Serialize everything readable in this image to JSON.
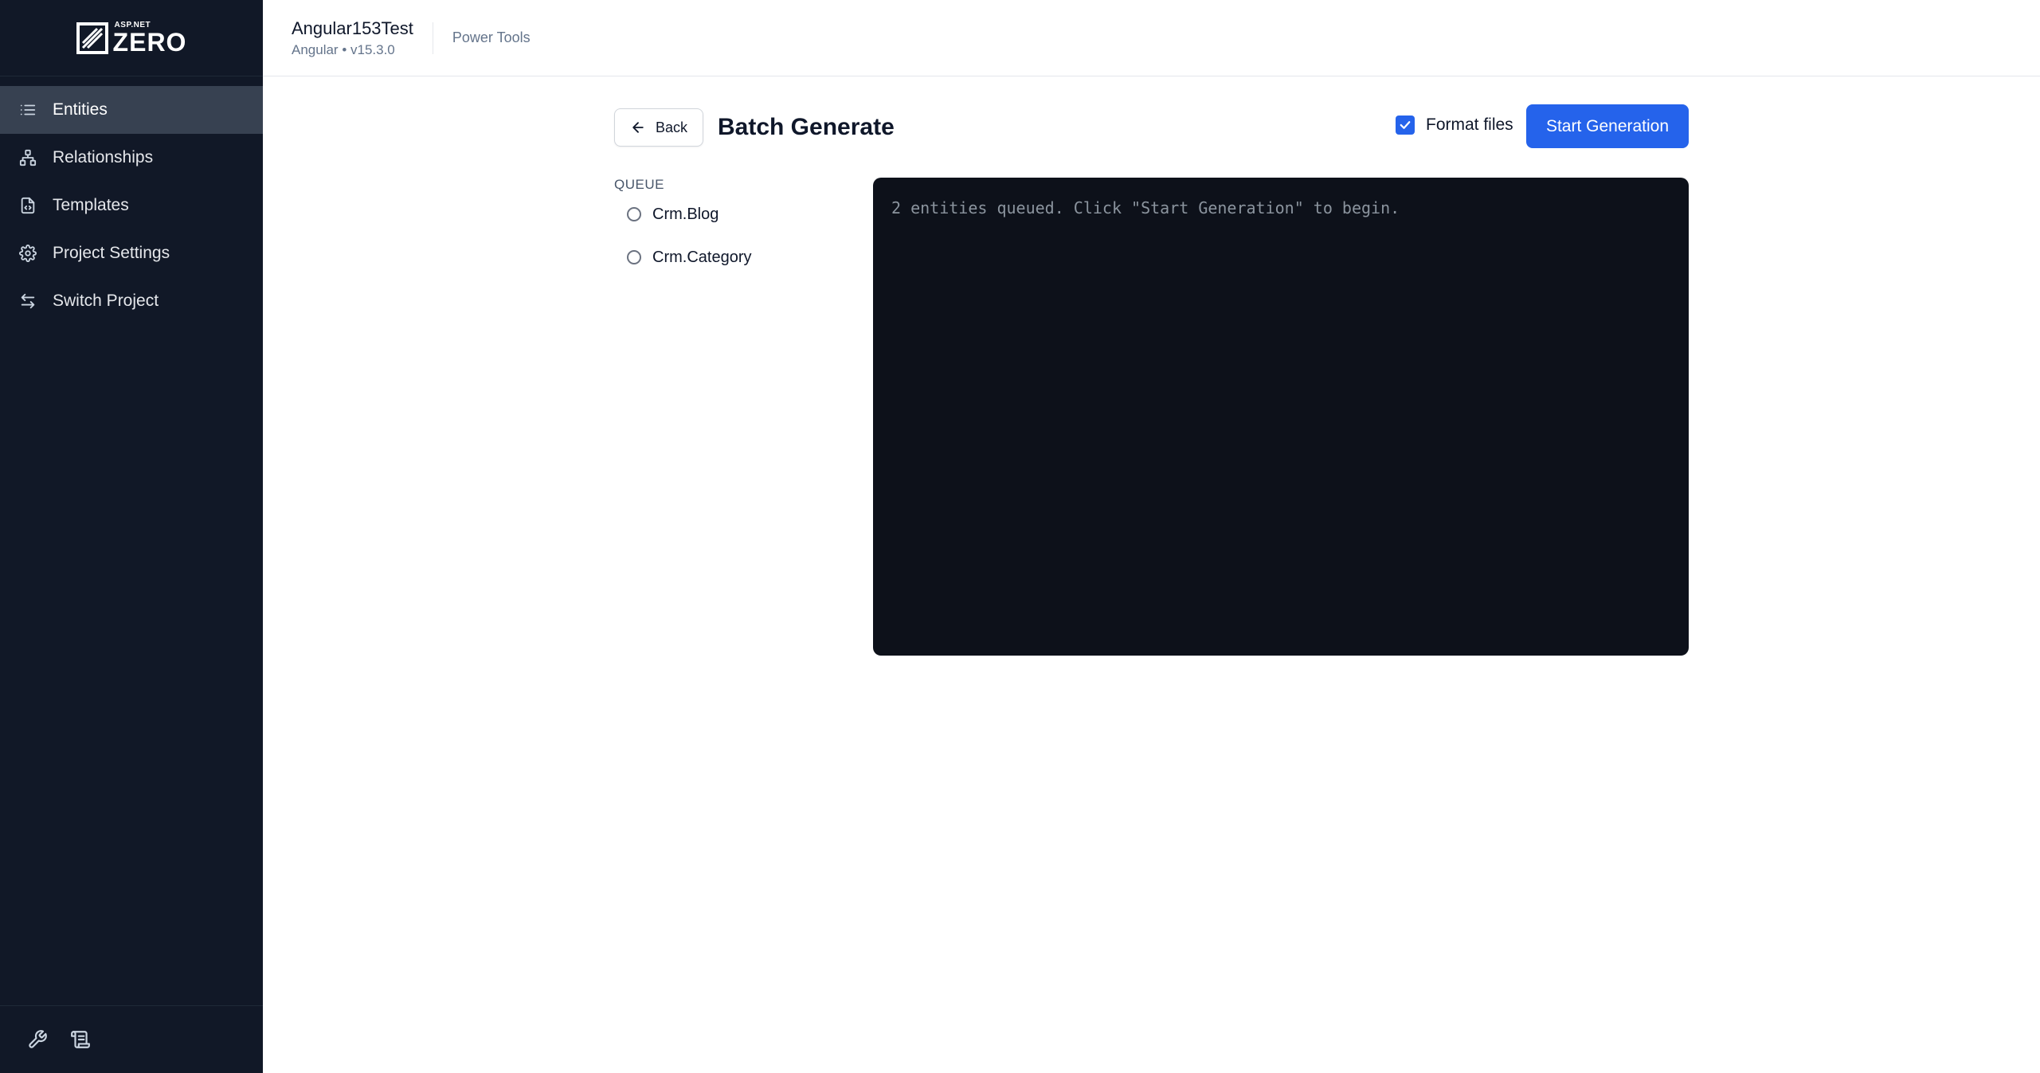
{
  "app": {
    "logo": {
      "small": "ASP.NET",
      "big": "ZERO"
    }
  },
  "sidebar": {
    "items": [
      {
        "label": "Entities",
        "icon": "list-icon",
        "active": true
      },
      {
        "label": "Relationships",
        "icon": "relationship-icon",
        "active": false
      },
      {
        "label": "Templates",
        "icon": "template-file-icon",
        "active": false
      },
      {
        "label": "Project Settings",
        "icon": "gear-icon",
        "active": false
      },
      {
        "label": "Switch Project",
        "icon": "switch-arrows-icon",
        "active": false
      }
    ],
    "footer_icons": [
      "wrench-icon",
      "scroll-icon"
    ]
  },
  "header": {
    "project_name": "Angular153Test",
    "project_sub": "Angular • v15.3.0",
    "link": "Power Tools"
  },
  "toolbar": {
    "back_label": "Back",
    "title": "Batch Generate",
    "format_label": "Format files",
    "format_checked": true,
    "start_label": "Start Generation"
  },
  "queue": {
    "title": "QUEUE",
    "items": [
      "Crm.Blog",
      "Crm.Category"
    ]
  },
  "console": {
    "text": "2 entities queued. Click \"Start Generation\" to begin."
  },
  "colors": {
    "sidebar_bg": "#111827",
    "accent": "#2563eb",
    "console_bg": "#0d111a"
  }
}
